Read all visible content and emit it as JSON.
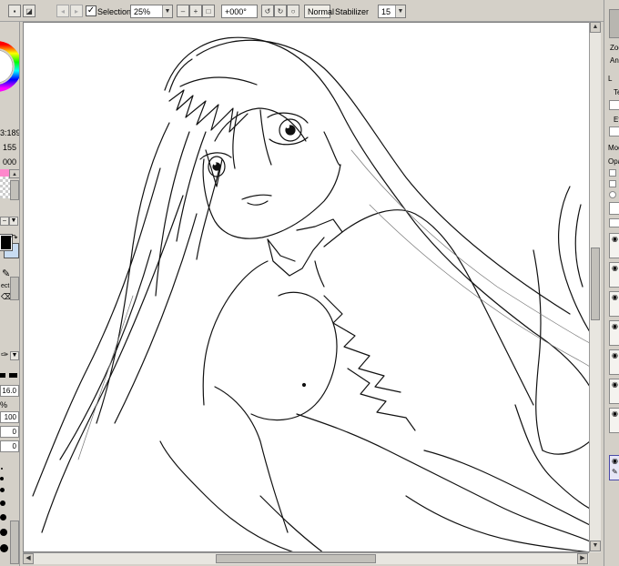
{
  "toolbar": {
    "selection_label": "Selection",
    "selection_checked": true,
    "zoom_value": "25%",
    "rotation_value": "+000°",
    "blend_mode": "Normal",
    "stabilizer_label": "Stabilizer",
    "stabilizer_value": "15"
  },
  "left_panel": {
    "color_readout": "3:189",
    "value_2": "155",
    "value_3": "000",
    "select_label": "ect",
    "brush_size": "16.0",
    "percent_label": "%",
    "density_value": "100",
    "zero_value_1": "0",
    "zero_value_2": "0",
    "primary_color": "#000000",
    "secondary_color": "#c8dcf2"
  },
  "right_panel": {
    "zoom_label": "Zoo",
    "angle_label": "Ang",
    "layer_label": "L",
    "te_label": "Te",
    "ef_label": "Ef",
    "mode_label": "Mod",
    "opacity_label": "Opa"
  },
  "icons": {
    "wheel_colors": [
      "#ff0000",
      "#ffff00",
      "#00ff00",
      "#00ffff",
      "#0000ff",
      "#ff00ff"
    ]
  }
}
